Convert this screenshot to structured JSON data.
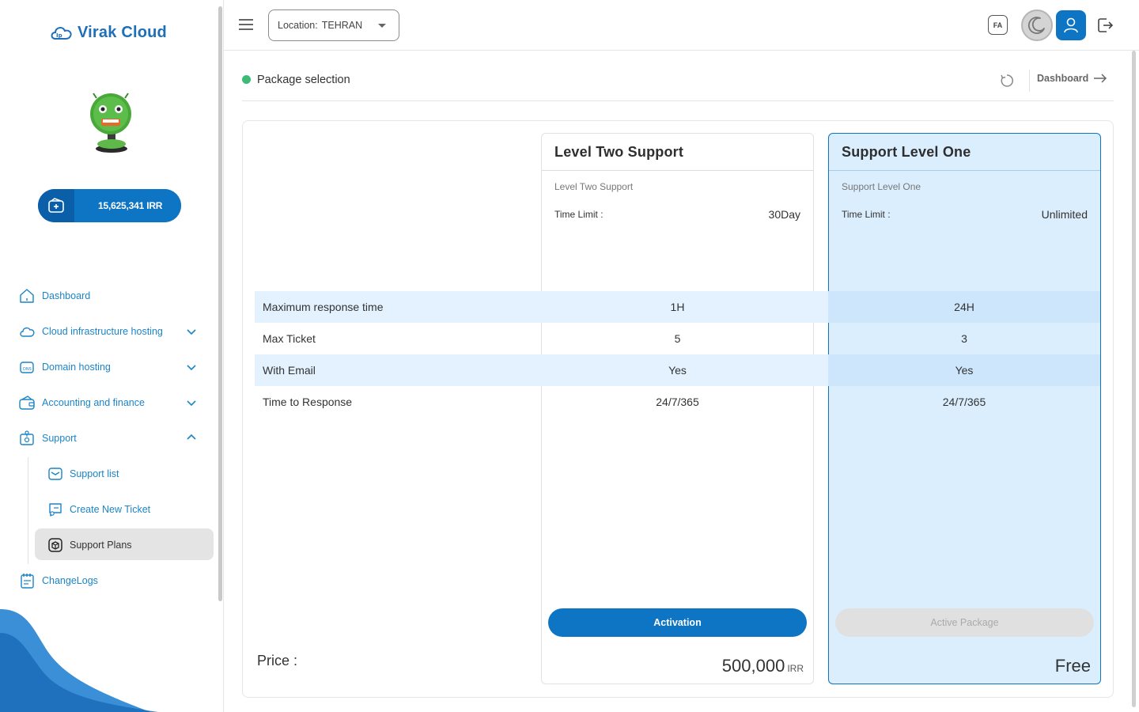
{
  "app": {
    "brand": "Virak Cloud",
    "wallet_amount": "15,625,341 IRR"
  },
  "colors": {
    "primary": "#0e74c4",
    "nav_text": "#1b84c7",
    "status_green": "#3dbb76",
    "plan_highlight": "#daeefe"
  },
  "sidebar": {
    "items": [
      {
        "label": "Dashboard",
        "icon": "home-icon"
      },
      {
        "label": "Cloud infrastructure hosting",
        "icon": "cloud-icon"
      },
      {
        "label": "Domain hosting",
        "icon": "dns-icon"
      },
      {
        "label": "Accounting and finance",
        "icon": "wallet-icon"
      },
      {
        "label": "Support",
        "icon": "support-icon"
      }
    ],
    "support_sub": [
      {
        "label": "Support list",
        "icon": "mail-icon"
      },
      {
        "label": "Create New Ticket",
        "icon": "ticket-icon"
      },
      {
        "label": "Support Plans",
        "icon": "box-icon"
      }
    ],
    "changelogs": {
      "label": "ChangeLogs",
      "icon": "notes-icon"
    }
  },
  "header": {
    "location_label": "Location:",
    "location_value": "TEHRAN",
    "lang_button": "FA"
  },
  "page": {
    "title": "Package selection",
    "breadcrumb": "Dashboard"
  },
  "plans": [
    {
      "title": "Level Two Support",
      "subtitle": "Level Two Support",
      "time_limit_label": "Time Limit :",
      "time_limit_value": "30Day",
      "button": "Activation",
      "price": "500,000",
      "currency": "IRR"
    },
    {
      "title": "Support Level One",
      "subtitle": "Support Level One",
      "time_limit_label": "Time Limit :",
      "time_limit_value": "Unlimited",
      "button": "Active Package",
      "price": "Free",
      "currency": ""
    }
  ],
  "features": [
    {
      "label": "Maximum response time",
      "values": [
        "1H",
        "24H"
      ]
    },
    {
      "label": "Max Ticket",
      "values": [
        "5",
        "3"
      ]
    },
    {
      "label": "With Email",
      "values": [
        "Yes",
        "Yes"
      ]
    },
    {
      "label": "Time to Response",
      "values": [
        "24/7/365",
        "24/7/365"
      ]
    }
  ],
  "price_label": "Price :"
}
